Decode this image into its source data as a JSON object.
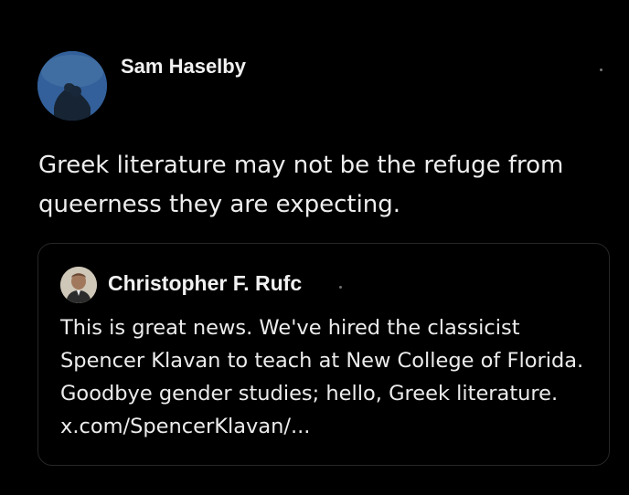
{
  "tweet": {
    "author": {
      "name": "Sam Haselby",
      "avatar_icon": "landscape-photo-avatar"
    },
    "text": "Greek literature may not be the refuge from queerness they are expecting.",
    "more_icon": "more-options-icon",
    "quoted": {
      "author": {
        "name": "Christopher F. Rufc",
        "avatar_icon": "portrait-photo-avatar"
      },
      "text": "This is great news. We've hired the classicist Spencer Klavan to teach at New College of Florida. Goodbye gender studies; hello, Greek literature.",
      "link": "x.com/SpencerKlavan/..."
    }
  },
  "colors": {
    "background": "#000000",
    "text": "#eeeeee",
    "card_border": "#262626"
  }
}
